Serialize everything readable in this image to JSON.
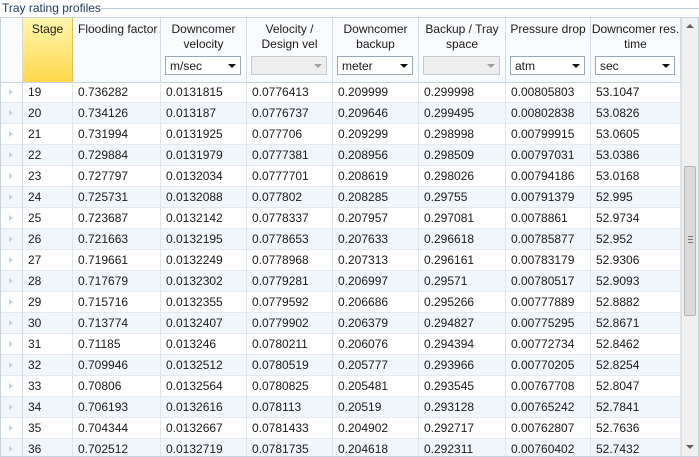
{
  "panel": {
    "title": "Tray rating profiles"
  },
  "columns": [
    {
      "key": "stage",
      "label": "Stage",
      "unit": null
    },
    {
      "key": "flood",
      "label": "Flooding factor",
      "unit": null
    },
    {
      "key": "dcvel",
      "label": "Downcomer velocity",
      "unit": "m/sec",
      "enabled": true
    },
    {
      "key": "veldes",
      "label": "Velocity / Design vel",
      "unit": "",
      "enabled": false
    },
    {
      "key": "dcback",
      "label": "Downcomer backup",
      "unit": "meter",
      "enabled": true
    },
    {
      "key": "backtray",
      "label": "Backup / Tray space",
      "unit": "",
      "enabled": false
    },
    {
      "key": "pdrop",
      "label": "Pressure drop",
      "unit": "atm",
      "enabled": true
    },
    {
      "key": "dctime",
      "label": "Downcomer res. time",
      "unit": "sec",
      "enabled": true
    }
  ],
  "rows": [
    [
      "19",
      "0.736282",
      "0.0131815",
      "0.0776413",
      "0.209999",
      "0.299998",
      "0.00805803",
      "53.1047"
    ],
    [
      "20",
      "0.734126",
      "0.013187",
      "0.0776737",
      "0.209646",
      "0.299495",
      "0.00802838",
      "53.0826"
    ],
    [
      "21",
      "0.731994",
      "0.0131925",
      "0.077706",
      "0.209299",
      "0.298998",
      "0.00799915",
      "53.0605"
    ],
    [
      "22",
      "0.729884",
      "0.0131979",
      "0.0777381",
      "0.208956",
      "0.298509",
      "0.00797031",
      "53.0386"
    ],
    [
      "23",
      "0.727797",
      "0.0132034",
      "0.0777701",
      "0.208619",
      "0.298026",
      "0.00794186",
      "53.0168"
    ],
    [
      "24",
      "0.725731",
      "0.0132088",
      "0.077802",
      "0.208285",
      "0.29755",
      "0.00791379",
      "52.995"
    ],
    [
      "25",
      "0.723687",
      "0.0132142",
      "0.0778337",
      "0.207957",
      "0.297081",
      "0.0078861",
      "52.9734"
    ],
    [
      "26",
      "0.721663",
      "0.0132195",
      "0.0778653",
      "0.207633",
      "0.296618",
      "0.00785877",
      "52.952"
    ],
    [
      "27",
      "0.719661",
      "0.0132249",
      "0.0778968",
      "0.207313",
      "0.296161",
      "0.00783179",
      "52.9306"
    ],
    [
      "28",
      "0.717679",
      "0.0132302",
      "0.0779281",
      "0.206997",
      "0.29571",
      "0.00780517",
      "52.9093"
    ],
    [
      "29",
      "0.715716",
      "0.0132355",
      "0.0779592",
      "0.206686",
      "0.295266",
      "0.00777889",
      "52.8882"
    ],
    [
      "30",
      "0.713774",
      "0.0132407",
      "0.0779902",
      "0.206379",
      "0.294827",
      "0.00775295",
      "52.8671"
    ],
    [
      "31",
      "0.71185",
      "0.013246",
      "0.0780211",
      "0.206076",
      "0.294394",
      "0.00772734",
      "52.8462"
    ],
    [
      "32",
      "0.709946",
      "0.0132512",
      "0.0780519",
      "0.205777",
      "0.293966",
      "0.00770205",
      "52.8254"
    ],
    [
      "33",
      "0.70806",
      "0.0132564",
      "0.0780825",
      "0.205481",
      "0.293545",
      "0.00767708",
      "52.8047"
    ],
    [
      "34",
      "0.706193",
      "0.0132616",
      "0.078113",
      "0.20519",
      "0.293128",
      "0.00765242",
      "52.7841"
    ],
    [
      "35",
      "0.704344",
      "0.0132667",
      "0.0781433",
      "0.204902",
      "0.292717",
      "0.00762807",
      "52.7636"
    ],
    [
      "36",
      "0.702512",
      "0.0132719",
      "0.0781735",
      "0.204618",
      "0.292311",
      "0.00760402",
      "52.7432"
    ]
  ]
}
